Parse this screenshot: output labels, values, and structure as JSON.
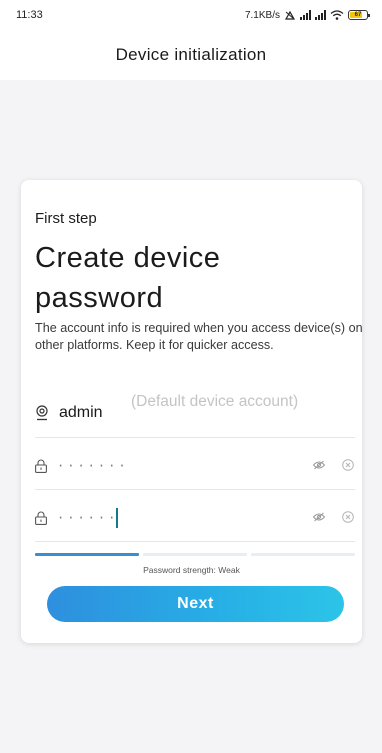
{
  "status_bar": {
    "time": "11:33",
    "network_speed": "7.1KB/s",
    "battery_level": "67"
  },
  "header": {
    "title": "Device initialization"
  },
  "card": {
    "step_label": "First step",
    "title": "Create device password",
    "description": "The account info is required when you access device(s) on other platforms. Keep it for quicker access.",
    "account": {
      "username": "admin",
      "hint": "(Default device account)"
    },
    "password_field": {
      "masked_value": "·······"
    },
    "confirm_password_field": {
      "masked_value": "······"
    },
    "strength": {
      "label": "Password strength: Weak",
      "filled_segments": 1,
      "total_segments": 3
    },
    "next_button_label": "Next"
  },
  "colors": {
    "accent": "#2e8fde",
    "accent_end": "#2cc4e8",
    "caret": "#127a8a",
    "background": "#f4f4f6"
  }
}
